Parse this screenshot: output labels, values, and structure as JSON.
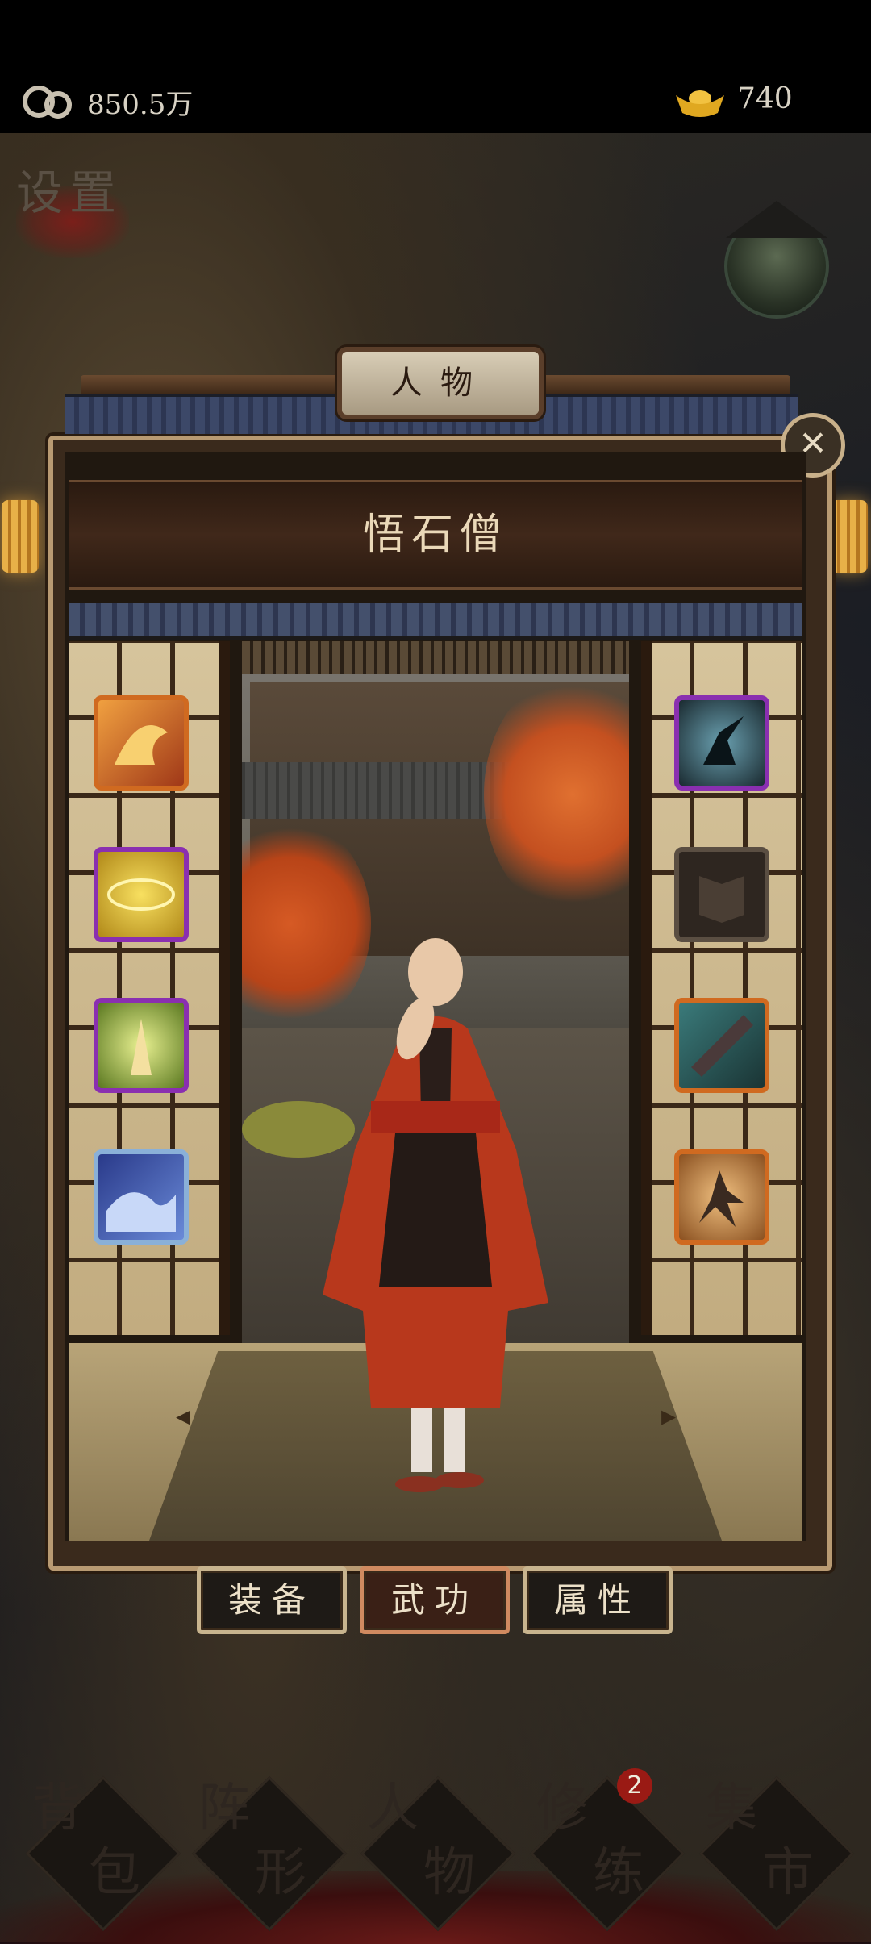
{
  "currency": {
    "coins": "850.5万",
    "ingots": "740"
  },
  "map": {
    "settings_label": "设置"
  },
  "panel": {
    "title": "人物",
    "character_name": "悟石僧",
    "tabs": [
      {
        "label": "装备",
        "active": false
      },
      {
        "label": "武功",
        "active": true
      },
      {
        "label": "属性",
        "active": false
      }
    ],
    "skills_left": [
      "dragon-fire-skill-icon",
      "golden-orb-skill-icon",
      "prayer-beads-skill-icon",
      "blue-wave-skill-icon"
    ],
    "skills_right": [
      "leaping-figure-skill-icon",
      "book-skill-icon",
      "guqin-skill-icon",
      "kungfu-stance-skill-icon"
    ]
  },
  "bottom_nav": {
    "items": [
      {
        "line1": "背",
        "line2": "包"
      },
      {
        "line1": "阵",
        "line2": "形"
      },
      {
        "line1": "人",
        "line2": "物"
      },
      {
        "line1": "修",
        "line2": "练"
      },
      {
        "line1": "集",
        "line2": "市"
      }
    ],
    "training_badge": "2"
  },
  "colors": {
    "accent": "#c8b48e",
    "active_tab": "#d08a60",
    "badge": "#9a1a14"
  }
}
